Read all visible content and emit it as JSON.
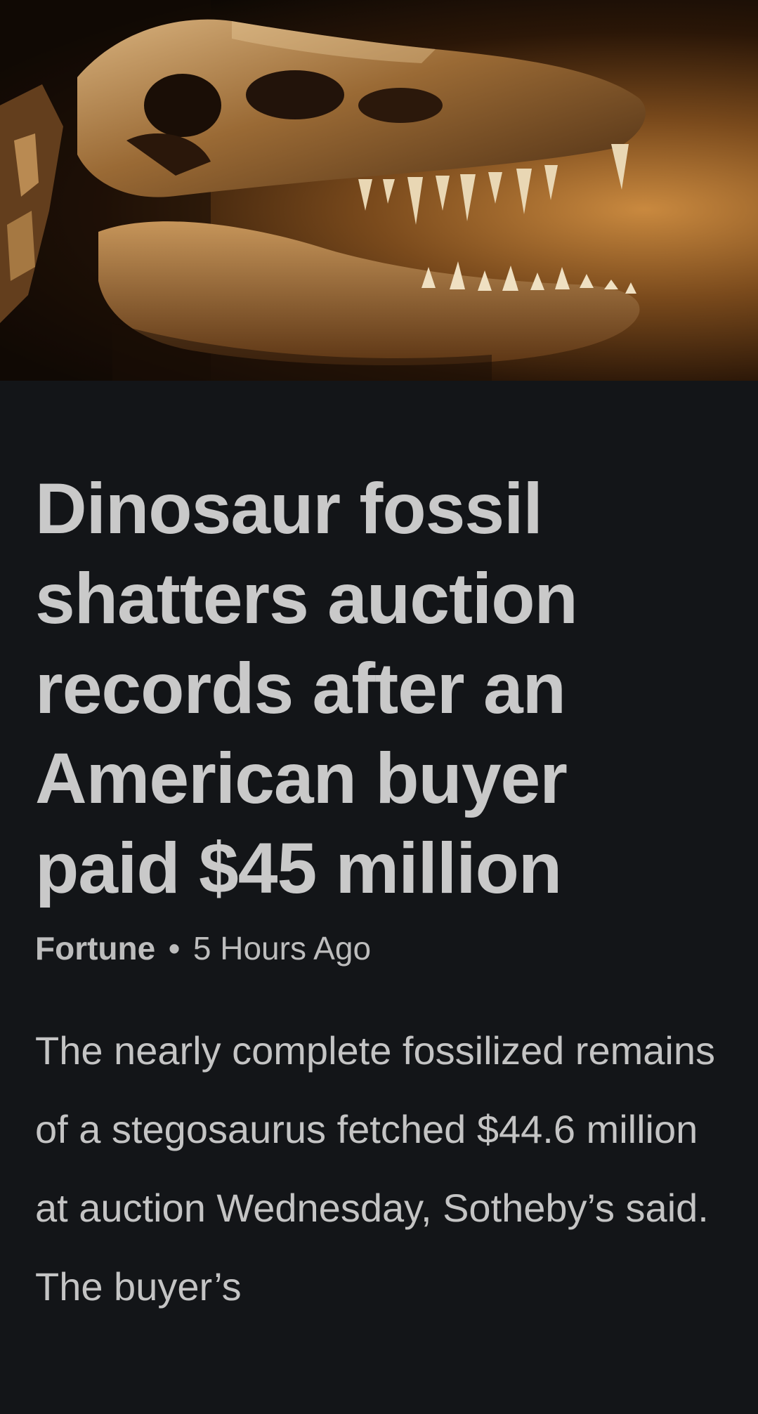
{
  "article": {
    "headline": "Dinosaur fossil shatters auction records after an American buyer paid $45 million",
    "source": "Fortune",
    "separator": "•",
    "time": "5 Hours Ago",
    "body": "The nearly complete fossilized remains of a stegosaurus fetched $44.6 million at auction Wednesday, Sotheby’s said. The buyer’s"
  },
  "hero": {
    "icon": "dinosaur-skull-photo"
  }
}
